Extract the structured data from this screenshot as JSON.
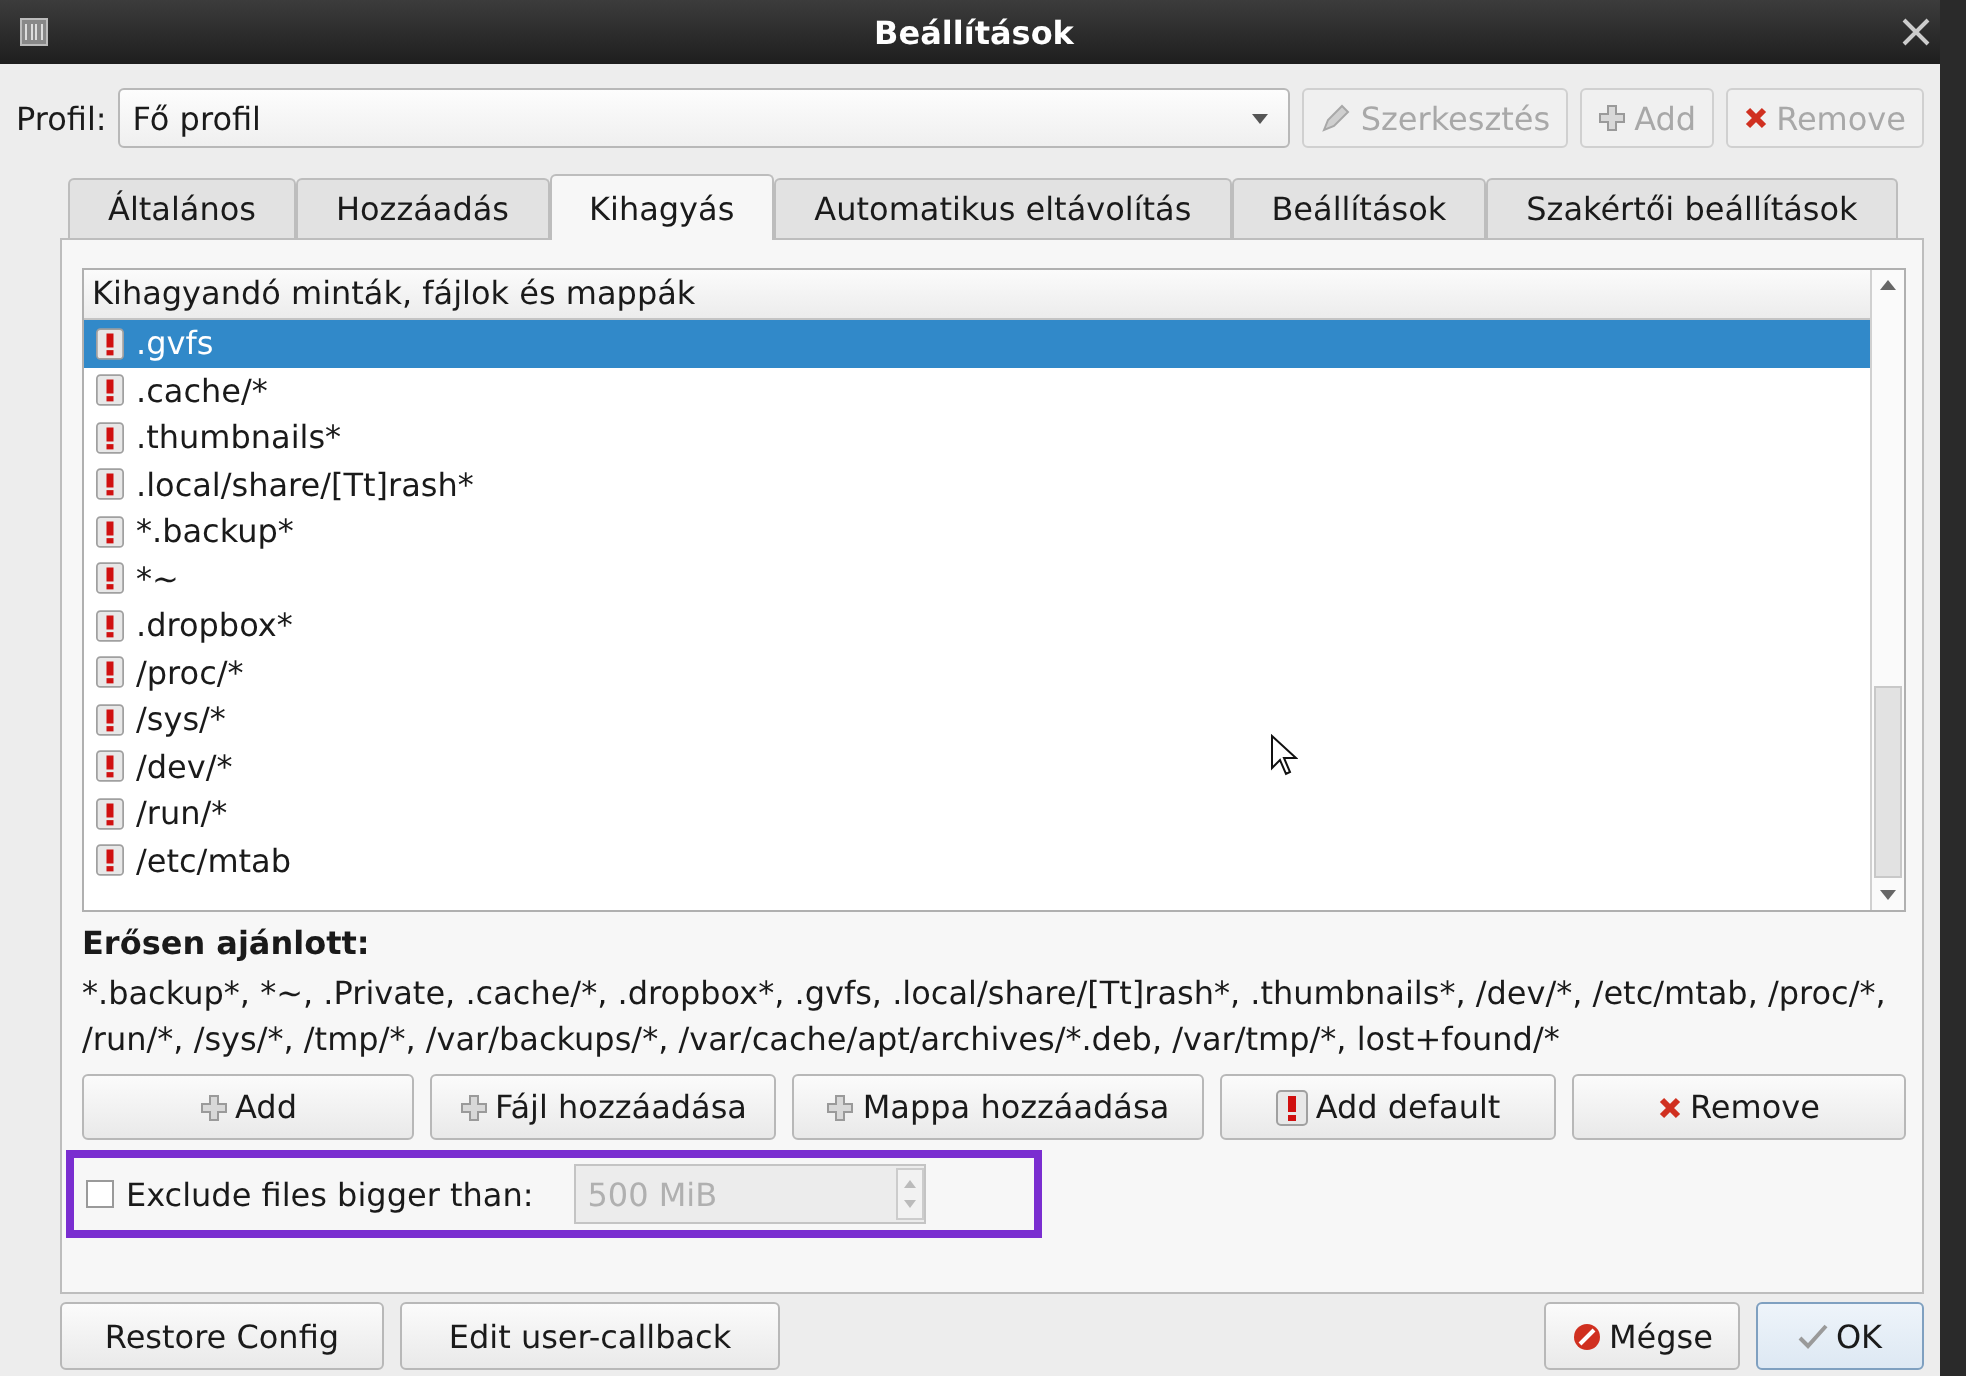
{
  "window": {
    "title": "Beállítások"
  },
  "profile": {
    "label": "Profil:",
    "value": "Fő profil"
  },
  "profile_buttons": [
    {
      "label": "Szerkesztés",
      "kind": "edit",
      "disabled": true
    },
    {
      "label": "Add",
      "kind": "add",
      "disabled": true
    },
    {
      "label": "Remove",
      "kind": "remove",
      "disabled": true
    }
  ],
  "tabs": [
    {
      "label": "Általános",
      "selected": false
    },
    {
      "label": "Hozzáadás",
      "selected": false
    },
    {
      "label": "Kihagyás",
      "selected": true
    },
    {
      "label": "Automatikus eltávolítás",
      "selected": false
    },
    {
      "label": "Beállítások",
      "selected": false
    },
    {
      "label": "Szakértői beállítások",
      "selected": false
    }
  ],
  "exclude_list": {
    "header": "Kihagyandó minták, fájlok és mappák",
    "items": [
      {
        "pattern": ".gvfs",
        "selected": true
      },
      {
        "pattern": ".cache/*",
        "selected": false
      },
      {
        "pattern": ".thumbnails*",
        "selected": false
      },
      {
        "pattern": ".local/share/[Tt]rash*",
        "selected": false
      },
      {
        "pattern": "*.backup*",
        "selected": false
      },
      {
        "pattern": "*~",
        "selected": false
      },
      {
        "pattern": ".dropbox*",
        "selected": false
      },
      {
        "pattern": "/proc/*",
        "selected": false
      },
      {
        "pattern": "/sys/*",
        "selected": false
      },
      {
        "pattern": "/dev/*",
        "selected": false
      },
      {
        "pattern": "/run/*",
        "selected": false
      },
      {
        "pattern": "/etc/mtab",
        "selected": false
      }
    ]
  },
  "recommended": {
    "title": "Erősen ajánlott:",
    "text": "*.backup*, *~, .Private, .cache/*, .dropbox*, .gvfs, .local/share/[Tt]rash*, .thumbnails*, /dev/*, /etc/mtab, /proc/*, /run/*, /sys/*, /tmp/*, /var/backups/*, /var/cache/apt/archives/*.deb, /var/tmp/*, lost+found/*"
  },
  "list_buttons": [
    {
      "label": "Add",
      "kind": "add"
    },
    {
      "label": "Fájl hozzáadása",
      "kind": "add"
    },
    {
      "label": "Mappa hozzáadása",
      "kind": "add"
    },
    {
      "label": "Add default",
      "kind": "warning"
    },
    {
      "label": "Remove",
      "kind": "remove"
    }
  ],
  "size_limit": {
    "label": "Exclude files bigger than:",
    "checked": false,
    "value": "500 MiB",
    "disabled": true
  },
  "footer_buttons": [
    {
      "label": "Restore Config"
    },
    {
      "label": "Edit user-callback"
    }
  ],
  "dialog_buttons": [
    {
      "label": "Mégse",
      "kind": "cancel"
    },
    {
      "label": "OK",
      "kind": "ok"
    }
  ]
}
